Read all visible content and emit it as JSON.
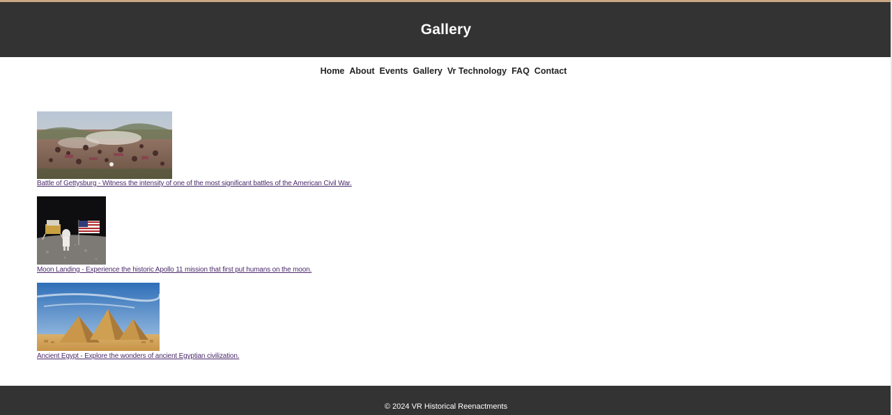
{
  "header": {
    "title": "Gallery"
  },
  "nav": {
    "items": [
      {
        "label": "Home"
      },
      {
        "label": "About"
      },
      {
        "label": "Events"
      },
      {
        "label": "Gallery"
      },
      {
        "label": "Vr Technology"
      },
      {
        "label": "FAQ"
      },
      {
        "label": "Contact"
      }
    ]
  },
  "gallery": {
    "items": [
      {
        "caption": "Battle of Gettysburg - Witness the intensity of one of the most significant battles of the American Civil War."
      },
      {
        "caption": "Moon Landing - Experience the historic Apollo 11 mission that first put humans on the moon."
      },
      {
        "caption": "Ancient Egypt - Explore the wonders of ancient Egyptian civilization."
      }
    ]
  },
  "footer": {
    "text": "© 2024 VR Historical Reenactments"
  },
  "colors": {
    "header_bg": "#333333",
    "footer_bg": "#333333",
    "link_visited": "#4a2a6a",
    "accent_strip": "#c9a883"
  }
}
